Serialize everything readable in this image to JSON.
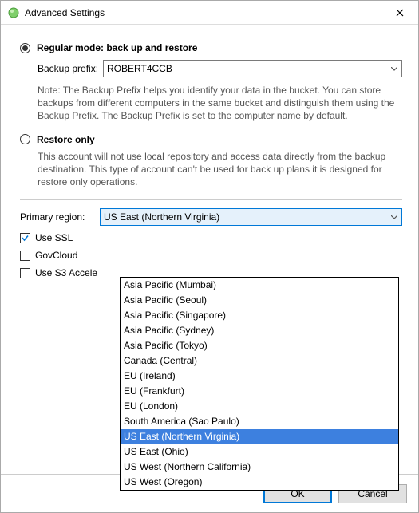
{
  "window": {
    "title": "Advanced Settings"
  },
  "mode": {
    "regular_label": "Regular mode: back up and restore",
    "restore_label": "Restore only",
    "restore_note": "This account will not use local repository and access data directly from the backup destination. This type of account can't be used for back up plans it is designed for restore only operations."
  },
  "prefix": {
    "label": "Backup prefix:",
    "value": "ROBERT4CCB",
    "note": "Note: The Backup Prefix helps you identify your data in the bucket. You can store backups from different computers in the same bucket and distinguish them using the Backup Prefix. The Backup Prefix is set to the computer name by default."
  },
  "region": {
    "label": "Primary region:",
    "selected": "US East (Northern Virginia)",
    "options": [
      "Asia Pacific (Mumbai)",
      "Asia Pacific (Seoul)",
      "Asia Pacific (Singapore)",
      "Asia Pacific (Sydney)",
      "Asia Pacific (Tokyo)",
      "Canada (Central)",
      "EU (Ireland)",
      "EU (Frankfurt)",
      "EU (London)",
      "South America (Sao Paulo)",
      "US East (Northern Virginia)",
      "US East (Ohio)",
      "US West (Northern California)",
      "US West (Oregon)"
    ],
    "highlighted_index": 10
  },
  "checkboxes": {
    "use_ssl": {
      "label": "Use SSL",
      "checked": true
    },
    "govcloud": {
      "label": "GovCloud",
      "checked": false
    },
    "s3_accel": {
      "label": "Use S3 Accele",
      "checked": false
    }
  },
  "buttons": {
    "ok": "OK",
    "cancel": "Cancel"
  }
}
